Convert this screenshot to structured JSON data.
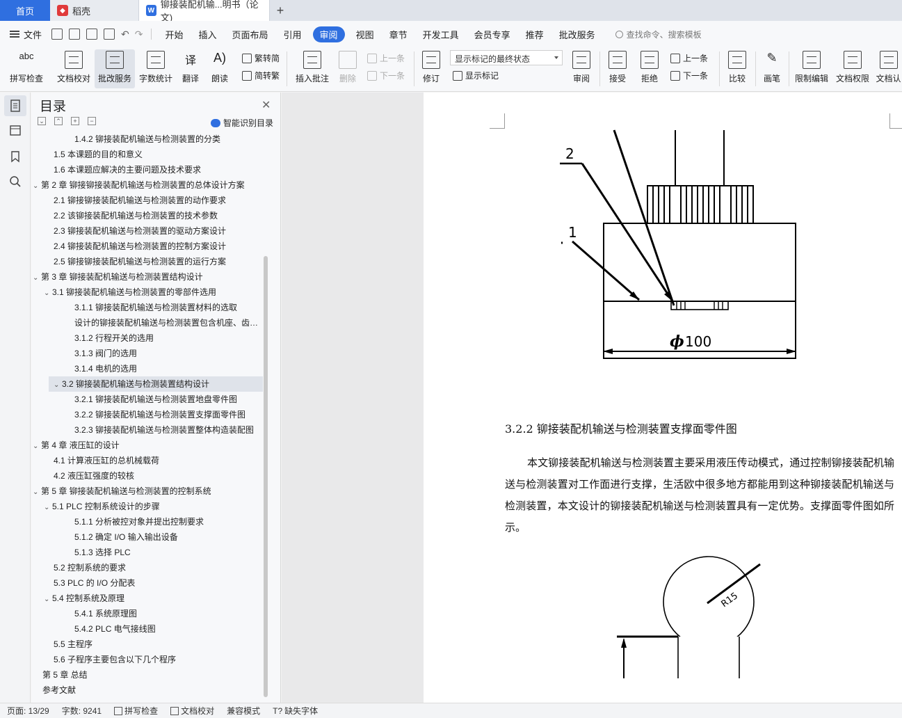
{
  "tabs": {
    "home": "首页",
    "daoke": "稻壳",
    "doc": "铆接装配机输...明书（论文)",
    "plus": "+"
  },
  "menubar": {
    "file": "文件",
    "items": [
      "开始",
      "插入",
      "页面布局",
      "引用",
      "审阅",
      "视图",
      "章节",
      "开发工具",
      "会员专享",
      "推荐",
      "批改服务"
    ],
    "active_index": 4,
    "search": "查找命令、搜索模板"
  },
  "ribbon": {
    "spell": "拼写检查",
    "proof": "文档校对",
    "correct": "批改服务",
    "wordcount": "字数统计",
    "translate": "翻译",
    "read": "朗读",
    "trad": "繁转简",
    "simp": "简转繁",
    "insert_comment": "插入批注",
    "delete": "删除",
    "prev_comment": "上一条",
    "next_comment": "下一条",
    "track": "修订",
    "markup_combo": "显示标记的最终状态",
    "show_markup": "显示标记",
    "review": "审阅",
    "accept": "接受",
    "reject": "拒绝",
    "prev": "上一条",
    "next": "下一条",
    "compare": "比较",
    "pen": "画笔",
    "restrict": "限制编辑",
    "permission": "文档权限",
    "cert": "文档认"
  },
  "toc": {
    "title": "目录",
    "smart": "智能识别目录",
    "items": [
      {
        "text": "1.4.2 铆接装配机输送与检测装置的分类",
        "level": 3
      },
      {
        "text": "1.5 本课题的目的和意义",
        "level": 2
      },
      {
        "text": "1.6  本课题应解决的主要问题及技术要求",
        "level": 2
      },
      {
        "text": "第 2 章  铆接铆接装配机输送与检测装置的总体设计方案",
        "level": 1,
        "chev": "v"
      },
      {
        "text": "2.1  铆接铆接装配机输送与检测装置的动作要求",
        "level": 2
      },
      {
        "text": "2.2 该铆接装配机输送与检测装置的技术参数",
        "level": 2
      },
      {
        "text": "2.3 铆接装配机输送与检测装置的驱动方案设计",
        "level": 2
      },
      {
        "text": "2.4 铆接装配机输送与检测装置的控制方案设计",
        "level": 2
      },
      {
        "text": "2.5 铆接铆接装配机输送与检测装置的运行方案",
        "level": 2
      },
      {
        "text": "第 3 章  铆接装配机输送与检测装置结构设计",
        "level": 1,
        "chev": "v"
      },
      {
        "text": "3.1 铆接装配机输送与检测装置的零部件选用",
        "level": 2,
        "chev": "v"
      },
      {
        "text": "3.1.1 铆接装配机输送与检测装置材料的选取",
        "level": 3
      },
      {
        "text": "设计的铆接装配机输送与检测装置包含机座、齿轮...",
        "level": 3
      },
      {
        "text": "3.1.2 行程开关的选用",
        "level": 3
      },
      {
        "text": "3.1.3 阀门的选用",
        "level": 3
      },
      {
        "text": "3.1.4 电机的选用",
        "level": 3
      },
      {
        "text": "3.2 铆接装配机输送与检测装置结构设计",
        "level": 2,
        "chev": "v",
        "selected": true
      },
      {
        "text": "3.2.1 铆接装配机输送与检测装置地盘零件图",
        "level": 3
      },
      {
        "text": "3.2.2 铆接装配机输送与检测装置支撑面零件图",
        "level": 3
      },
      {
        "text": "3.2.3 铆接装配机输送与检测装置整体构造装配图",
        "level": 3
      },
      {
        "text": "第 4 章  液压缸的设计",
        "level": 1,
        "chev": "v"
      },
      {
        "text": "4.1 计算液压缸的总机械载荷",
        "level": 2
      },
      {
        "text": "4.2 液压缸强度的较核",
        "level": 2
      },
      {
        "text": "第 5 章  铆接装配机输送与检测装置的控制系统",
        "level": 1,
        "chev": "v"
      },
      {
        "text": "5.1 PLC 控制系统设计的步骤",
        "level": 2,
        "chev": "v"
      },
      {
        "text": "5.1.1 分析被控对象并提出控制要求",
        "level": 3
      },
      {
        "text": "5.1.2 确定 I/O 输入输出设备",
        "level": 3
      },
      {
        "text": "5.1.3 选择 PLC",
        "level": 3
      },
      {
        "text": "5.2 控制系统的要求",
        "level": 2
      },
      {
        "text": "5.3 PLC 的 I/O 分配表",
        "level": 2
      },
      {
        "text": "5.4  控制系统及原理",
        "level": 2,
        "chev": "v"
      },
      {
        "text": "5.4.1 系统原理图",
        "level": 3
      },
      {
        "text": "5.4.2 PLC 电气接线图",
        "level": 3
      },
      {
        "text": "5.5 主程序",
        "level": 2
      },
      {
        "text": "5.6 子程序主要包含以下几个程序",
        "level": 2
      },
      {
        "text": "第 5 章  总结",
        "level": 1
      },
      {
        "text": "参考文献",
        "level": 1
      }
    ]
  },
  "document": {
    "label_2": "2",
    "label_1": "1",
    "dim_phi": "ϕ",
    "dim_value": "100",
    "dim_r15": "R15",
    "heading": "3.2.2 铆接装配机输送与检测装置支撑面零件图",
    "paragraph": "本文铆接装配机输送与检测装置主要采用液压传动模式，通过控制铆接装配机输送与检测装置对工作面进行支撑，生活欧中很多地方都能用到这种铆接装配机输送与检测装置，本文设计的铆接装配机输送与检测装置具有一定优势。支撑面零件图如所示。"
  },
  "status": {
    "page": "页面: 13/29",
    "words": "字数: 9241",
    "spell": "拼写检查",
    "proof": "文档校对",
    "compat": "兼容模式",
    "missing_font": "缺失字体"
  }
}
